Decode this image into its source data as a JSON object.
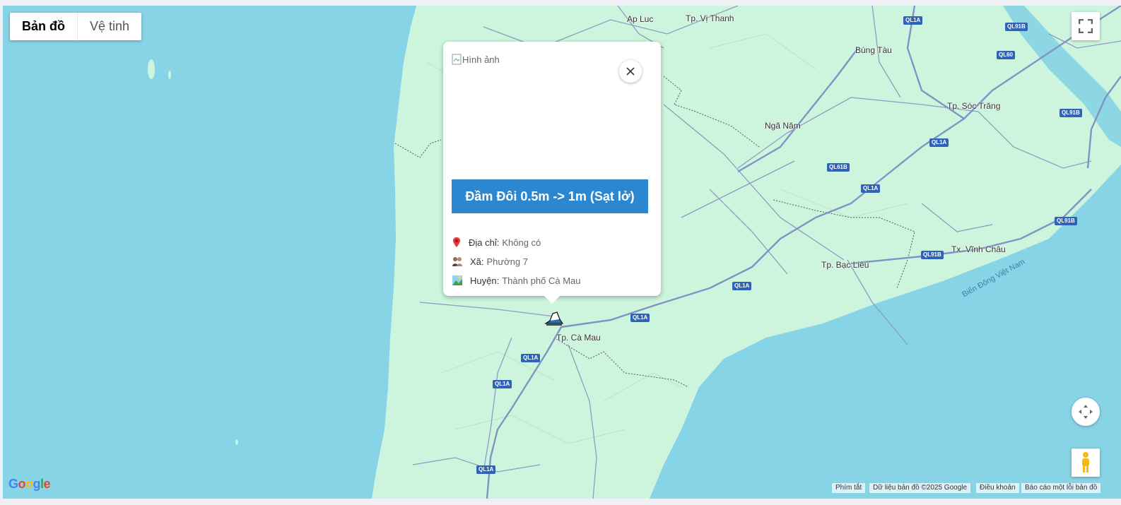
{
  "map_type": {
    "map_label": "Bản đồ",
    "satellite_label": "Vệ tinh"
  },
  "places": {
    "ap_luc": "Ap Luc",
    "vi_thanh": "Tp. Vị Thanh",
    "bung_tau": "Búng Tàu",
    "soc_trang": "Tp. Sóc Trăng",
    "nga_nam": "Ngã Năm",
    "bac_lieu": "Tp. Bạc Liêu",
    "vinh_chau": "Tx. Vĩnh Châu",
    "ca_mau": "Tp. Cà Mau",
    "sea": "Biển Đông Việt Nam"
  },
  "road_shields": {
    "s1": "QL1A",
    "s2": "QL91B",
    "s3": "QL60",
    "s4": "QL91B",
    "s5": "QL1A",
    "s6": "QL61B",
    "s7": "QL1A",
    "s8": "QL91B",
    "s9": "QL91B",
    "s10": "QL1A",
    "s11": "QL1A",
    "s12": "QL1A",
    "s13": "QL1A",
    "s14": "QL1A"
  },
  "popup": {
    "image_alt": "Hình ảnh",
    "title": "Đầm Đôi 0.5m -> 1m (Sạt lở)",
    "address_label": "Địa chỉ:",
    "address_value": "Không có",
    "commune_label": "Xã:",
    "commune_value": "Phường 7",
    "district_label": "Huyện:",
    "district_value": "Thành phố Cà Mau"
  },
  "attribution": {
    "shortcuts": "Phím tắt",
    "map_data": "Dữ liệu bản đồ ©2025 Google",
    "terms": "Điều khoản",
    "report": "Báo cáo một lỗi bản đồ"
  },
  "colors": {
    "water": "#86d4e6",
    "land": "#cdf5de",
    "accent": "#2b88d0",
    "shield": "#2f63b8"
  },
  "icons": {
    "fullscreen": "fullscreen-icon",
    "camera": "camera-control-icon",
    "pegman": "pegman-icon",
    "close": "close-icon",
    "marker": "landslide-marker-icon"
  }
}
